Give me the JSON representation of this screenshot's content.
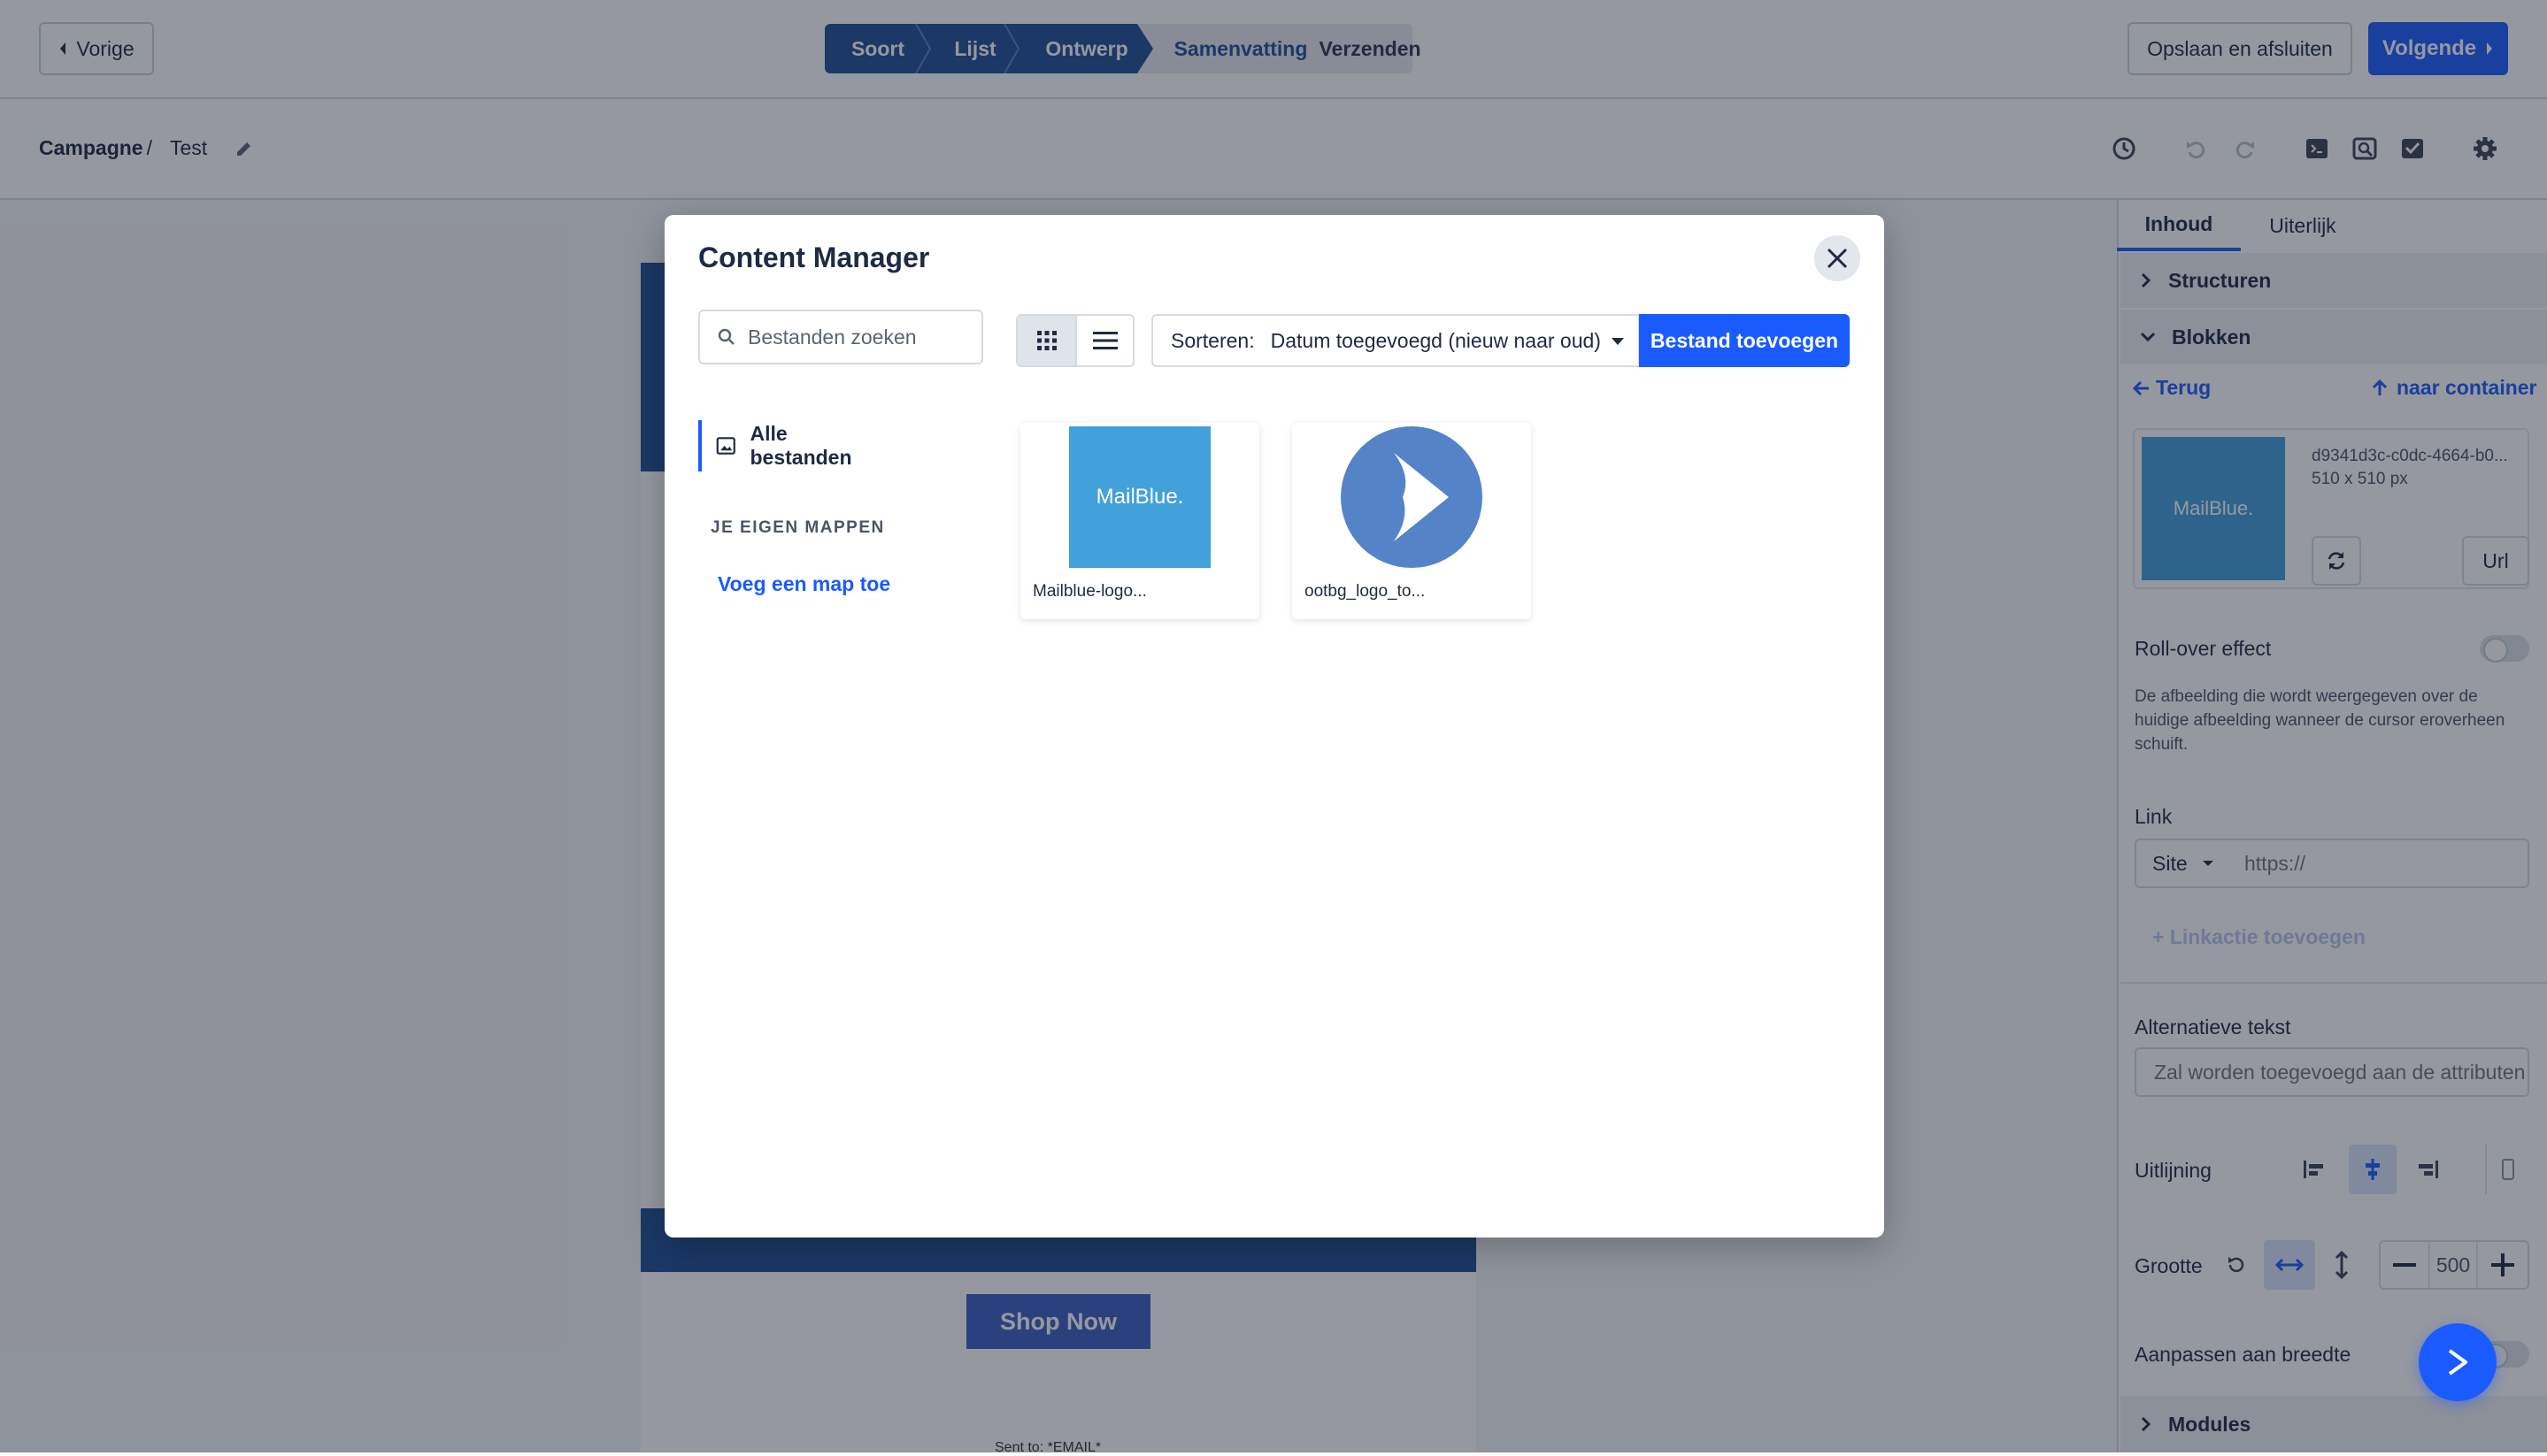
{
  "topbar": {
    "prev_label": "Vorige",
    "steps": [
      "Soort",
      "Lijst",
      "Ontwerp",
      "Samenvatting",
      "Verzenden"
    ],
    "save_label": "Opslaan en afsluiten",
    "next_label": "Volgende"
  },
  "breadcrumb": {
    "parent": "Campagne",
    "separator": "/",
    "current": "Test"
  },
  "email_preview": {
    "shop_button": "Shop Now",
    "sent_to": "Sent to: *EMAIL*"
  },
  "right_panel": {
    "tabs": [
      "Inhoud",
      "Uiterlijk"
    ],
    "sections": {
      "structures": "Structuren",
      "blocks": "Blokken",
      "modules": "Modules"
    },
    "back_link": "Terug",
    "container_link": "naar container",
    "image": {
      "name": "d9341d3c-c0dc-4664-b0...",
      "dims": "510 x 510 px",
      "logo_text": "MailBlue.",
      "url_button": "Url"
    },
    "rollover_label": "Roll-over effect",
    "rollover_help": "De afbeelding die wordt weergegeven over de huidige afbeelding wanneer de cursor eroverheen schuift.",
    "link_label": "Link",
    "link_type": "Site",
    "link_placeholder": "https://",
    "add_link_action": "+ Linkactie toevoegen",
    "alt_label": "Alternatieve tekst",
    "alt_placeholder": "Zal worden toegevoegd aan de attributen",
    "align_label": "Uitlijning",
    "size_label": "Grootte",
    "size_value": "500",
    "fit_width_label": "Aanpassen aan breedte"
  },
  "modal": {
    "title": "Content Manager",
    "search_placeholder": "Bestanden zoeken",
    "sort_label": "Sorteren:",
    "sort_value": "Datum toegevoegd (nieuw naar oud)",
    "add_file_label": "Bestand toevoegen",
    "nav_all": "Alle bestanden",
    "folders_heading": "JE EIGEN MAPPEN",
    "add_folder": "Voeg een map toe",
    "files": [
      {
        "name": "Mailblue-logo...",
        "thumb_text": "MailBlue."
      },
      {
        "name": "ootbg_logo_to..."
      }
    ]
  },
  "colors": {
    "accent": "#1a5bff",
    "brand_navy": "#1f4e96",
    "mailblue": "#42a0db",
    "ootbg_blue": "#5583c7"
  }
}
